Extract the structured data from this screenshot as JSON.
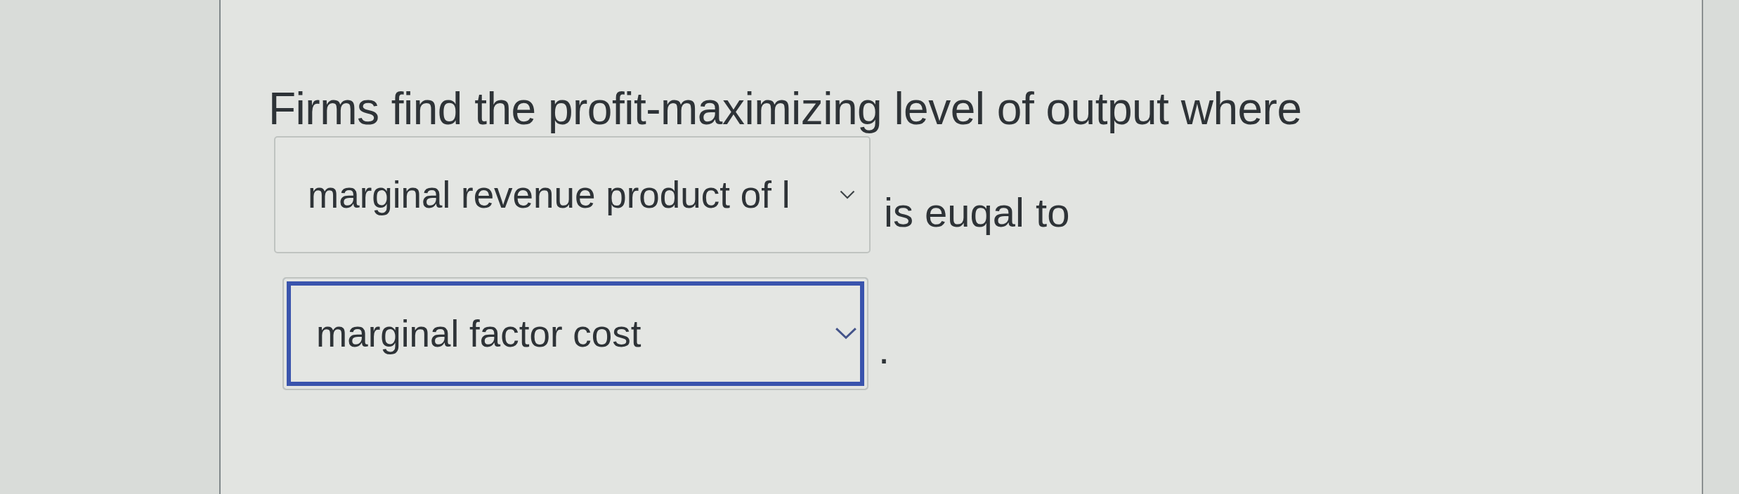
{
  "prompt": "Firms find the profit-maximizing level of output where",
  "blanks": [
    {
      "value": "marginal revenue product of l",
      "focused": false,
      "after": "is euqal to"
    },
    {
      "value": "marginal factor cost",
      "focused": true,
      "after": "."
    }
  ]
}
